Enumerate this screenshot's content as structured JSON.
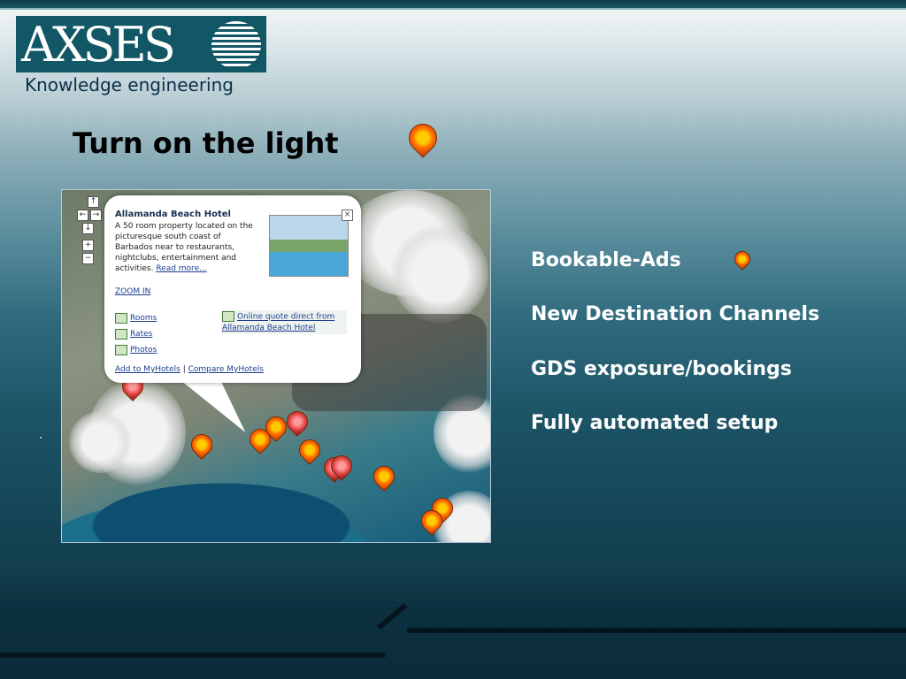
{
  "logo": {
    "text": "AXSES",
    "subtitle": "Knowledge engineering",
    "icon": "globe-stripes-icon"
  },
  "slide": {
    "title": "Turn on the light",
    "title_icon": "map-pin-icon",
    "dot": "."
  },
  "map": {
    "info_window": {
      "hotel_name": "Allamanda Beach Hotel",
      "description": "A 50 room property located on the picturesque south coast of Barbados near to restaurants, nightclubs, entertainment and activities.",
      "read_more": "Read more...",
      "zoom_in": "ZOOM IN",
      "links": [
        "Rooms",
        "Rates",
        "Photos"
      ],
      "quote_link": "Online quote direct from Allamanda Beach Hotel",
      "add_link": "Add to MyHotels",
      "separator": "|",
      "compare_link": "Compare MyHotels",
      "close": "×"
    },
    "nav_controls": {
      "up": "↑",
      "left": "←",
      "right": "→",
      "down": "↓",
      "zoom_in": "+",
      "zoom_out": "−"
    }
  },
  "bullets": [
    {
      "text": "Bookable-Ads",
      "icon": "map-pin-icon"
    },
    {
      "text": "New Destination Channels"
    },
    {
      "text": "GDS exposure/bookings"
    },
    {
      "text": "Fully automated setup"
    }
  ],
  "colors": {
    "logo_bg": "#115766",
    "bullet_text": "#ffffff",
    "title_text": "#000000"
  }
}
